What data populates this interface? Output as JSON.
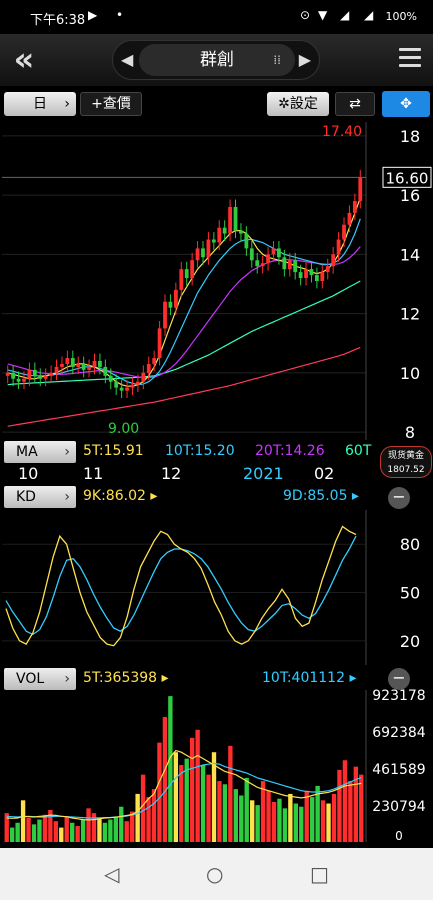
{
  "status_bar": {
    "time": "下午6:38",
    "battery": "100%"
  },
  "header": {
    "title": "群創"
  },
  "toolbar": {
    "period": "日",
    "add_price": "+查價",
    "settings": "✲設定"
  },
  "price_chart": {
    "axis_ticks": [
      "18",
      "16",
      "14",
      "12",
      "10",
      "8"
    ],
    "high_label": "17.40",
    "low_label": "9.00",
    "current_price": "16.60"
  },
  "ma": {
    "label": "MA",
    "values": [
      "5T:15.91",
      "10T:15.20",
      "20T:14.26",
      "60T"
    ],
    "colors": [
      "#ffe14d",
      "#33ccff",
      "#cc33ff",
      "#33ffbb"
    ]
  },
  "time_axis": {
    "labels": [
      "10",
      "11",
      "12",
      "2021",
      "02"
    ]
  },
  "gold_ticker": {
    "name": "现货黄金",
    "value": "1807.52"
  },
  "kd": {
    "label": "KD",
    "k_value": "9K:86.02",
    "d_value": "9D:85.05",
    "axis_ticks": [
      "80",
      "50",
      "20"
    ]
  },
  "vol": {
    "label": "VOL",
    "ma5": "5T:365398",
    "ma10": "10T:401112",
    "axis_ticks": [
      "923178",
      "692384",
      "461589",
      "230794",
      "0"
    ]
  },
  "chart_data": [
    {
      "type": "candlestick",
      "title": "群創",
      "yticks": [
        8,
        10,
        12,
        14,
        16,
        18
      ],
      "ylim": [
        7.8,
        18.4
      ],
      "close": [
        10.0,
        9.8,
        9.7,
        9.8,
        10.1,
        9.9,
        9.8,
        9.9,
        10.0,
        10.2,
        10.3,
        10.5,
        10.2,
        10.3,
        10.1,
        10.2,
        10.4,
        10.2,
        9.9,
        9.7,
        9.5,
        9.4,
        9.5,
        9.6,
        9.7,
        10.0,
        10.3,
        10.5,
        11.5,
        12.4,
        12.2,
        12.8,
        13.5,
        13.2,
        13.8,
        14.2,
        13.9,
        14.5,
        14.4,
        14.9,
        14.7,
        15.6,
        14.8,
        14.7,
        14.2,
        13.8,
        13.6,
        13.7,
        14.0,
        14.2,
        13.9,
        13.5,
        13.8,
        13.4,
        13.2,
        13.5,
        13.3,
        13.1,
        13.4,
        13.6,
        14.0,
        14.5,
        15.0,
        15.4,
        15.8,
        16.6
      ],
      "ma5": [
        10.0,
        9.95,
        9.9,
        9.85,
        9.8,
        9.8,
        9.85,
        9.9,
        9.95,
        10.0,
        10.1,
        10.2,
        10.25,
        10.3,
        10.3,
        10.25,
        10.2,
        10.1,
        10.0,
        9.85,
        9.7,
        9.6,
        9.55,
        9.55,
        9.6,
        9.7,
        9.9,
        10.2,
        10.6,
        11.1,
        11.6,
        12.1,
        12.6,
        12.9,
        13.2,
        13.5,
        13.7,
        13.9,
        14.1,
        14.3,
        14.5,
        14.7,
        14.8,
        14.8,
        14.7,
        14.5,
        14.2,
        14.0,
        13.9,
        13.85,
        13.8,
        13.75,
        13.7,
        13.6,
        13.55,
        13.5,
        13.4,
        13.35,
        13.4,
        13.5,
        13.7,
        14.0,
        14.4,
        14.9,
        15.4,
        15.91
      ],
      "ma10": [
        10.1,
        10.05,
        10.0,
        9.95,
        9.92,
        9.9,
        9.9,
        9.9,
        9.92,
        9.95,
        10.0,
        10.05,
        10.1,
        10.15,
        10.2,
        10.2,
        10.2,
        10.15,
        10.1,
        10.0,
        9.9,
        9.8,
        9.7,
        9.65,
        9.6,
        9.62,
        9.7,
        9.85,
        10.05,
        10.35,
        10.7,
        11.1,
        11.5,
        11.9,
        12.3,
        12.7,
        13.0,
        13.3,
        13.55,
        13.8,
        14.0,
        14.2,
        14.35,
        14.45,
        14.5,
        14.5,
        14.45,
        14.4,
        14.3,
        14.2,
        14.1,
        14.0,
        13.95,
        13.9,
        13.85,
        13.8,
        13.75,
        13.7,
        13.65,
        13.65,
        13.7,
        13.8,
        14.0,
        14.3,
        14.7,
        15.2
      ],
      "ma20": [
        10.3,
        10.25,
        10.2,
        10.15,
        10.1,
        10.05,
        10.0,
        9.98,
        9.96,
        9.95,
        9.95,
        9.96,
        9.98,
        10.0,
        10.02,
        10.04,
        10.06,
        10.08,
        10.08,
        10.06,
        10.02,
        9.98,
        9.94,
        9.9,
        9.86,
        9.84,
        9.84,
        9.86,
        9.92,
        10.02,
        10.15,
        10.32,
        10.52,
        10.75,
        11.0,
        11.25,
        11.5,
        11.75,
        12.0,
        12.25,
        12.5,
        12.75,
        12.95,
        13.15,
        13.3,
        13.45,
        13.55,
        13.65,
        13.72,
        13.78,
        13.8,
        13.82,
        13.82,
        13.8,
        13.78,
        13.75,
        13.72,
        13.7,
        13.68,
        13.66,
        13.66,
        13.68,
        13.75,
        13.88,
        14.05,
        14.26
      ],
      "ma60": [
        9.6,
        9.62,
        9.63,
        9.64,
        9.65,
        9.66,
        9.67,
        9.68,
        9.69,
        9.7,
        9.71,
        9.72,
        9.73,
        9.74,
        9.75,
        9.76,
        9.77,
        9.78,
        9.79,
        9.8,
        9.81,
        9.82,
        9.83,
        9.84,
        9.85,
        9.86,
        9.88,
        9.9,
        9.95,
        10.0,
        10.06,
        10.12,
        10.2,
        10.28,
        10.36,
        10.44,
        10.52,
        10.6,
        10.7,
        10.8,
        10.9,
        11.0,
        11.1,
        11.2,
        11.3,
        11.4,
        11.48,
        11.56,
        11.64,
        11.72,
        11.8,
        11.88,
        11.96,
        12.04,
        12.12,
        12.2,
        12.28,
        12.36,
        12.44,
        12.52,
        12.6,
        12.7,
        12.8,
        12.9,
        13.0,
        13.1
      ],
      "ma120": [
        8.2,
        8.23,
        8.26,
        8.29,
        8.32,
        8.35,
        8.38,
        8.41,
        8.44,
        8.47,
        8.5,
        8.53,
        8.56,
        8.59,
        8.62,
        8.65,
        8.68,
        8.71,
        8.74,
        8.77,
        8.8,
        8.83,
        8.86,
        8.89,
        8.92,
        8.95,
        8.98,
        9.01,
        9.05,
        9.09,
        9.13,
        9.17,
        9.21,
        9.25,
        9.29,
        9.33,
        9.37,
        9.41,
        9.45,
        9.49,
        9.53,
        9.57,
        9.62,
        9.67,
        9.72,
        9.77,
        9.82,
        9.87,
        9.92,
        9.97,
        10.02,
        10.07,
        10.12,
        10.17,
        10.22,
        10.27,
        10.32,
        10.37,
        10.42,
        10.47,
        10.52,
        10.57,
        10.63,
        10.7,
        10.78,
        10.86
      ]
    },
    {
      "type": "line",
      "title": "KD",
      "yticks": [
        20,
        50,
        80
      ],
      "ylim": [
        5,
        100
      ],
      "series": [
        {
          "name": "9K",
          "values": [
            40,
            28,
            20,
            18,
            25,
            38,
            55,
            72,
            85,
            80,
            65,
            50,
            38,
            30,
            22,
            18,
            17,
            22,
            35,
            52,
            66,
            74,
            82,
            88,
            86,
            80,
            77,
            75,
            71,
            65,
            55,
            44,
            36,
            26,
            20,
            18,
            20,
            26,
            34,
            40,
            45,
            52,
            46,
            34,
            29,
            31,
            44,
            58,
            70,
            82,
            91,
            88,
            86.02
          ]
        },
        {
          "name": "9D",
          "values": [
            45,
            38,
            32,
            26,
            24,
            27,
            35,
            47,
            60,
            70,
            71,
            66,
            58,
            49,
            41,
            34,
            28,
            26,
            29,
            36,
            45,
            54,
            63,
            71,
            75,
            77,
            77,
            76,
            74,
            71,
            66,
            59,
            52,
            44,
            37,
            31,
            27,
            26,
            29,
            33,
            37,
            42,
            43,
            40,
            36,
            34,
            37,
            44,
            52,
            61,
            70,
            77,
            85.05
          ]
        }
      ]
    },
    {
      "type": "bar",
      "title": "VOL",
      "yticks": [
        0,
        230794,
        461589,
        692384,
        923178
      ],
      "ylim": [
        0,
        923178
      ],
      "values": [
        180000,
        90000,
        120000,
        260000,
        150000,
        110000,
        140000,
        170000,
        200000,
        130000,
        90000,
        160000,
        120000,
        100000,
        140000,
        210000,
        180000,
        150000,
        120000,
        140000,
        160000,
        220000,
        130000,
        190000,
        300000,
        420000,
        280000,
        330000,
        620000,
        780000,
        910000,
        560000,
        480000,
        520000,
        650000,
        700000,
        480000,
        420000,
        560000,
        380000,
        360000,
        600000,
        330000,
        290000,
        400000,
        260000,
        230000,
        380000,
        320000,
        250000,
        270000,
        210000,
        300000,
        240000,
        220000,
        320000,
        280000,
        350000,
        260000,
        240000,
        300000,
        450000,
        510000,
        380000,
        470000,
        420000
      ],
      "series": [
        {
          "name": "5T",
          "values": [
            150000,
            148000,
            150000,
            160000,
            158000,
            156000,
            160000,
            162000,
            168000,
            166000,
            160000,
            158000,
            150000,
            145000,
            140000,
            138000,
            140000,
            145000,
            150000,
            152000,
            155000,
            160000,
            165000,
            172000,
            190000,
            230000,
            270000,
            300000,
            380000,
            450000,
            530000,
            570000,
            560000,
            540000,
            520000,
            540000,
            520000,
            500000,
            480000,
            460000,
            440000,
            430000,
            420000,
            400000,
            380000,
            360000,
            340000,
            330000,
            320000,
            310000,
            300000,
            290000,
            285000,
            280000,
            275000,
            280000,
            290000,
            300000,
            305000,
            310000,
            320000,
            335000,
            350000,
            355000,
            360000,
            365398
          ]
        },
        {
          "name": "10T",
          "values": [
            160000,
            158000,
            156000,
            158000,
            160000,
            158000,
            156000,
            155000,
            158000,
            160000,
            160000,
            158000,
            156000,
            154000,
            152000,
            150000,
            150000,
            151000,
            152000,
            153000,
            155000,
            158000,
            162000,
            168000,
            178000,
            195000,
            215000,
            240000,
            275000,
            315000,
            360000,
            400000,
            430000,
            450000,
            460000,
            470000,
            480000,
            485000,
            490000,
            485000,
            470000,
            460000,
            450000,
            440000,
            430000,
            415000,
            400000,
            390000,
            380000,
            370000,
            360000,
            350000,
            340000,
            330000,
            320000,
            315000,
            312000,
            312000,
            315000,
            320000,
            330000,
            345000,
            360000,
            375000,
            390000,
            401112
          ]
        }
      ]
    }
  ]
}
